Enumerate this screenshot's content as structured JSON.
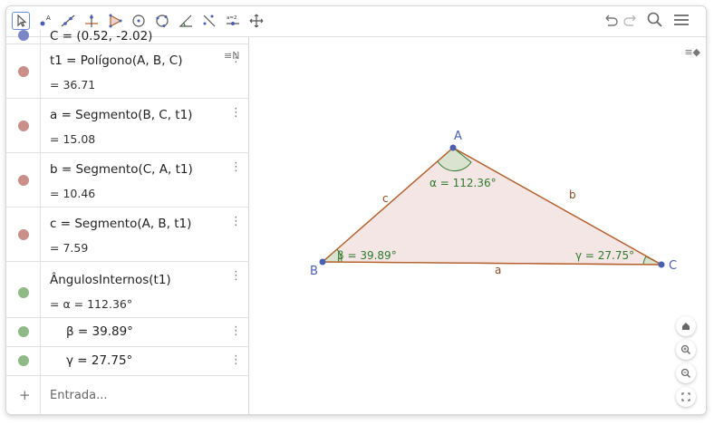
{
  "toolbar": {
    "tools": [
      {
        "name": "move-tool-icon",
        "selected": true
      },
      {
        "name": "point-tool-icon"
      },
      {
        "name": "line-tool-icon"
      },
      {
        "name": "perpendicular-tool-icon"
      },
      {
        "name": "polygon-tool-icon"
      },
      {
        "name": "circle-tool-icon"
      },
      {
        "name": "circle-three-points-tool-icon"
      },
      {
        "name": "angle-tool-icon"
      },
      {
        "name": "reflect-tool-icon"
      },
      {
        "name": "slider-tool-icon",
        "label": "a=2"
      },
      {
        "name": "move-graphics-tool-icon"
      }
    ],
    "right": [
      "undo-icon",
      "redo-icon",
      "search-icon",
      "menu-icon"
    ]
  },
  "algebra": {
    "partial_row": "C = (0.52, -2.02)",
    "rows": [
      {
        "def": "t1 = Polígono(A, B, C)",
        "value": "= 36.71",
        "color": "#c9908a"
      },
      {
        "def": "a = Segmento(B, C, t1)",
        "value": "= 15.08",
        "color": "#c9908a"
      },
      {
        "def": "b = Segmento(C, A, t1)",
        "value": "= 10.46",
        "color": "#c9908a"
      },
      {
        "def": "c = Segmento(A, B, t1)",
        "value": "= 7.59",
        "color": "#c9908a"
      },
      {
        "def": "ÂngulosInternos(t1)",
        "value": "= α = 112.36°",
        "color": "#8fba88"
      },
      {
        "def": "β = 39.89°",
        "value": "",
        "color": "#8fba88"
      },
      {
        "def": "γ = 27.75°",
        "value": "",
        "color": "#8fba88"
      }
    ],
    "input_placeholder": "Entrada...",
    "add_symbol": "+",
    "menu_symbol": "⋮"
  },
  "graphics": {
    "points": {
      "A": "A",
      "B": "B",
      "C": "C"
    },
    "segments": {
      "a": "a",
      "b": "b",
      "c": "c"
    },
    "angles": {
      "alpha": "α = 112.36°",
      "beta": "β = 39.89°",
      "gamma": "γ = 27.75°"
    },
    "colors": {
      "polygon_fill": "#f3e6e4",
      "polygon_stroke": "#b5612e",
      "point": "#4a5fb0",
      "angle": "#2f7a2f",
      "angle_fill": "#cfe0c8"
    }
  }
}
